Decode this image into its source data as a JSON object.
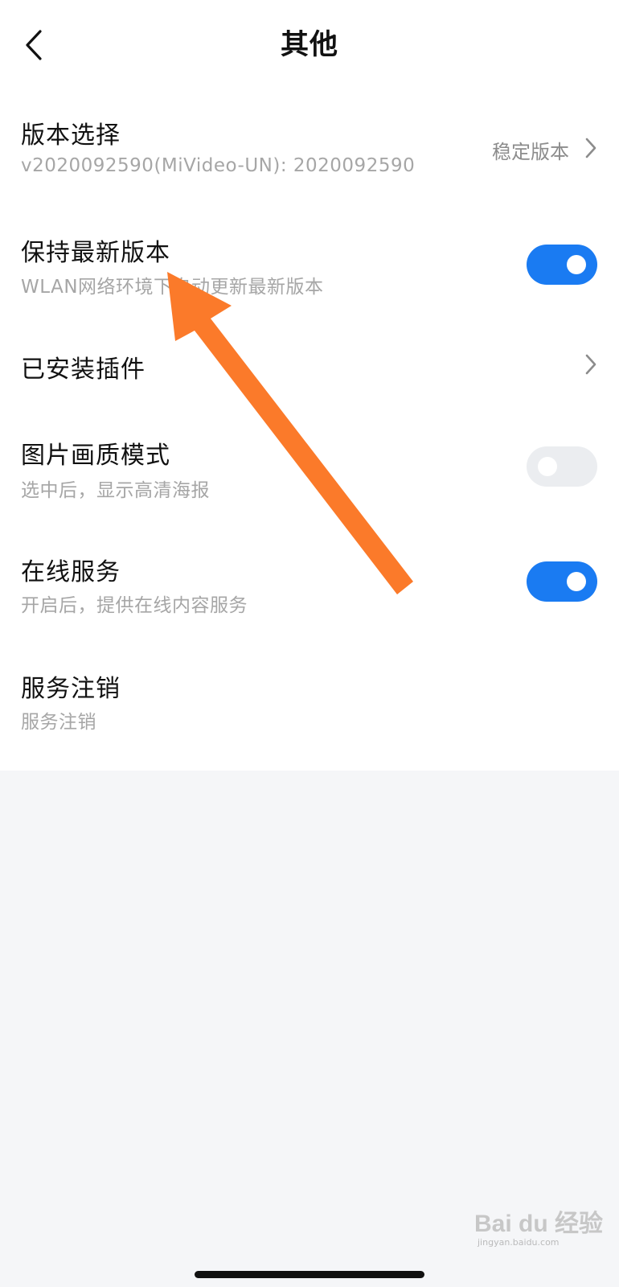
{
  "header": {
    "title": "其他",
    "back_icon": "chevron-left-icon"
  },
  "rows": [
    {
      "id": "version-select",
      "title": "版本选择",
      "subtitle": "v2020092590(MiVideo-UN): 2020092590",
      "value": "稳定版本",
      "control": "chevron"
    },
    {
      "id": "keep-latest",
      "title": "保持最新版本",
      "subtitle": "WLAN网络环境下自动更新最新版本",
      "control": "toggle",
      "on": true
    },
    {
      "id": "installed-plugins",
      "title": "已安装插件",
      "control": "chevron"
    },
    {
      "id": "image-quality",
      "title": "图片画质模式",
      "subtitle": "选中后，显示高清海报",
      "control": "toggle",
      "on": false
    },
    {
      "id": "online-service",
      "title": "在线服务",
      "subtitle": "开启后，提供在线内容服务",
      "control": "toggle",
      "on": true
    },
    {
      "id": "service-logout",
      "title": "服务注销",
      "subtitle": "服务注销"
    }
  ],
  "colors": {
    "accent": "#1a7bf2",
    "arrow": "#fb7a2a",
    "toggle_off": "#ebedf0"
  },
  "watermark": {
    "text": "Bai du 经验",
    "sub": "jingyan.baidu.com"
  }
}
